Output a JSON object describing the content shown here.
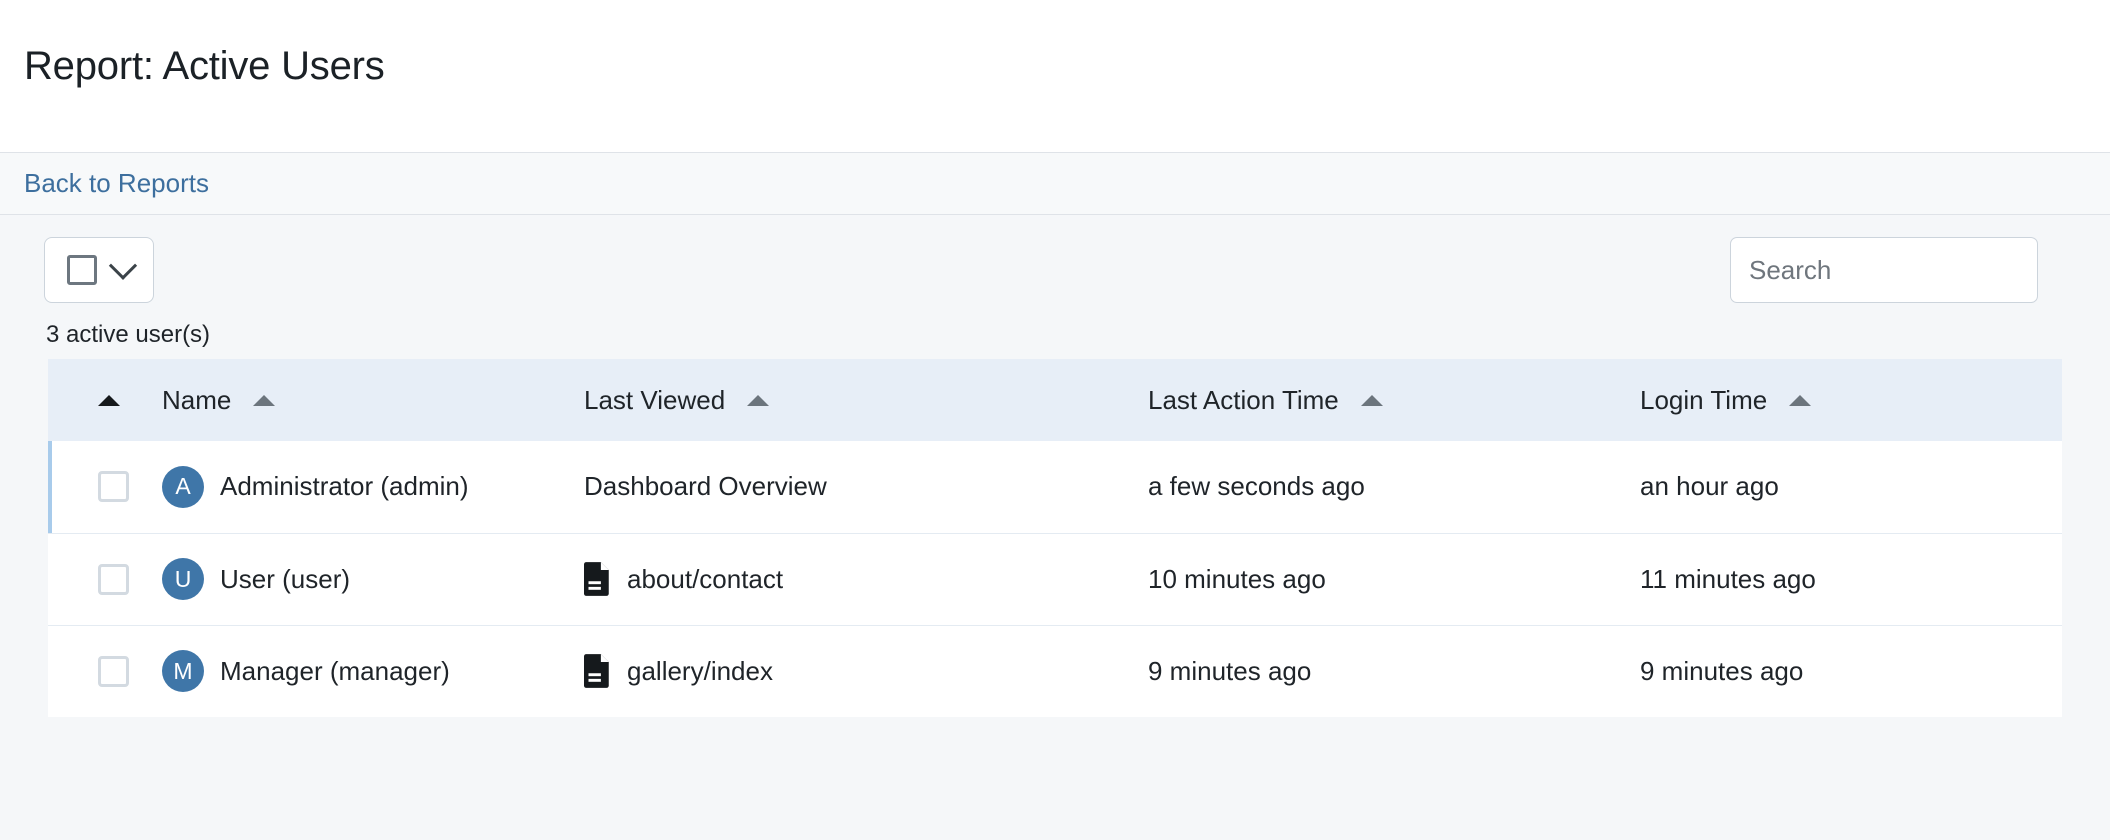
{
  "header": {
    "title": "Report: Active Users"
  },
  "breadcrumb": {
    "back_label": "Back to Reports"
  },
  "toolbar": {
    "bulk_select_icon": "checkbox-icon",
    "bulk_select_chevron_icon": "chevron-down-icon",
    "search_placeholder": "Search",
    "search_value": ""
  },
  "summary": {
    "count_text": "3 active user(s)"
  },
  "table": {
    "columns": [
      {
        "key": "check",
        "label": "",
        "sort_icon": "sort-ascending-icon",
        "sort_active": true
      },
      {
        "key": "name",
        "label": "Name",
        "sort_icon": "sort-ascending-icon",
        "sort_active": false
      },
      {
        "key": "viewed",
        "label": "Last Viewed",
        "sort_icon": "sort-ascending-icon",
        "sort_active": false
      },
      {
        "key": "action",
        "label": "Last Action Time",
        "sort_icon": "sort-ascending-icon",
        "sort_active": false
      },
      {
        "key": "login",
        "label": "Login Time",
        "sort_icon": "sort-ascending-icon",
        "sort_active": false
      }
    ],
    "rows": [
      {
        "selected": true,
        "avatar_letter": "A",
        "name": "Administrator (admin)",
        "last_viewed": "Dashboard Overview",
        "has_file_icon": false,
        "last_action_time": "a few seconds ago",
        "login_time": "an hour ago"
      },
      {
        "selected": false,
        "avatar_letter": "U",
        "name": "User (user)",
        "last_viewed": "about/contact",
        "has_file_icon": true,
        "last_action_time": "10 minutes ago",
        "login_time": "11 minutes ago"
      },
      {
        "selected": false,
        "avatar_letter": "M",
        "name": "Manager (manager)",
        "last_viewed": "gallery/index",
        "has_file_icon": true,
        "last_action_time": "9 minutes ago",
        "login_time": "9 minutes ago"
      }
    ]
  },
  "colors": {
    "accent_link": "#3d6f9e",
    "avatar_bg": "#3f76a8",
    "table_header_bg": "#e7eef7",
    "selected_row_bar": "#a8cbeb",
    "page_bg": "#f5f7f9"
  }
}
